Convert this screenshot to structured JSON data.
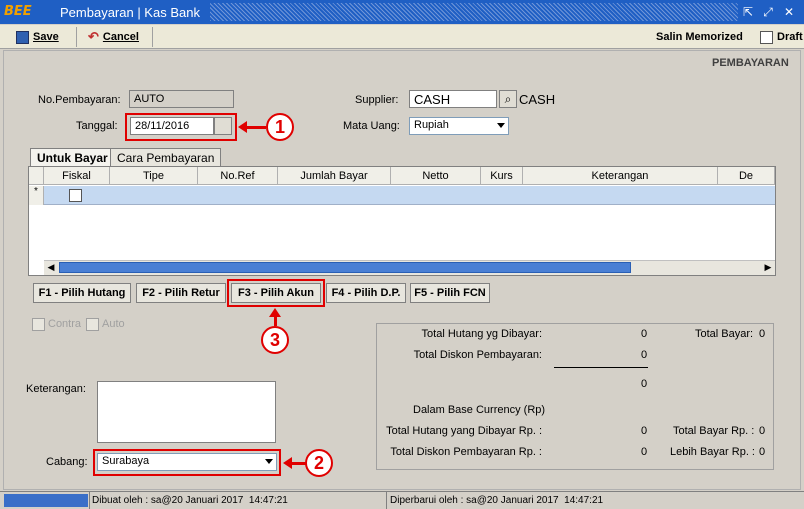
{
  "window": {
    "logo_text": "BEE",
    "title": "Pembayaran | Kas Bank"
  },
  "toolbar": {
    "save_label": "Save",
    "cancel_label": "Cancel",
    "salin_label": "Salin Memorized",
    "draft_label": "Draft",
    "draft_checked": false
  },
  "form": {
    "section_title": "PEMBAYARAN",
    "no_label": "No.Pembayaran:",
    "no_value": "AUTO",
    "tanggal_label": "Tanggal:",
    "tanggal_value": "28/11/2016",
    "supplier_label": "Supplier:",
    "supplier_code": "CASH",
    "supplier_name": "CASH",
    "currency_label": "Mata Uang:",
    "currency_value": "Rupiah"
  },
  "tabs": [
    "Untuk Bayar",
    "Cara Pembayaran"
  ],
  "grid": {
    "columns": [
      "Fiskal",
      "Tipe",
      "No.Ref",
      "Jumlah Bayar",
      "Netto",
      "Kurs",
      "Keterangan",
      "De"
    ],
    "new_row_marker": "*"
  },
  "function_buttons": [
    "F1 - Pilih Hutang",
    "F2 - Pilih Retur",
    "F3 - Pilih Akun",
    "F4 - Pilih D.P.",
    "F5 - Pilih FCN"
  ],
  "options": {
    "contra_label": "Contra",
    "auto_label": "Auto"
  },
  "notes": {
    "keterangan_label": "Keterangan:",
    "cabang_label": "Cabang:",
    "cabang_value": "Surabaya"
  },
  "summary": {
    "total_hutang_label": "Total Hutang yg Dibayar:",
    "total_hutang_value": "0",
    "total_bayar_label": "Total Bayar:",
    "total_bayar_value": "0",
    "total_diskon_label": "Total Diskon Pembayaran:",
    "total_diskon_value": "0",
    "subtotal_value": "0",
    "base_currency_label": "Dalam Base Currency (Rp)",
    "total_hutang_rp_label": "Total Hutang yang Dibayar Rp. :",
    "total_hutang_rp_value": "0",
    "total_bayar_rp_label": "Total Bayar Rp. :",
    "total_bayar_rp_value": "0",
    "total_diskon_rp_label": "Total Diskon Pembayaran Rp. :",
    "total_diskon_rp_value": "0",
    "lebih_bayar_rp_label": "Lebih Bayar Rp. :",
    "lebih_bayar_rp_value": "0"
  },
  "annotations": [
    "1",
    "2",
    "3"
  ],
  "status": {
    "dibuat": "Dibuat oleh : sa@20 Januari 2017  14:47:21",
    "diperbarui": "Diperbarui oleh : sa@20 Januari 2017  14:47:21"
  },
  "colors": {
    "title_bar": "#1f5fc4",
    "grid_selected_row": "#c5d9f1",
    "annotation_red": "#e00000"
  }
}
